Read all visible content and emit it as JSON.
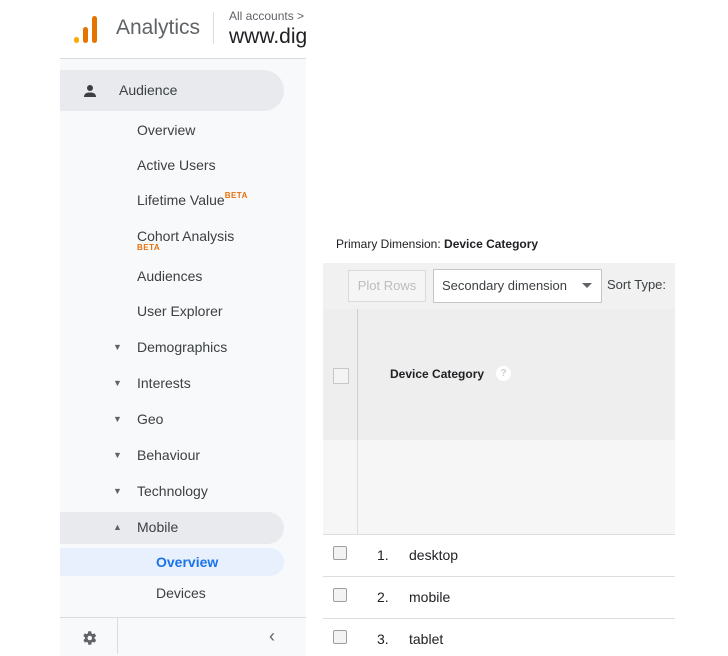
{
  "header": {
    "app_title": "Analytics",
    "all_accounts": "All accounts >",
    "property_name": "www.dig",
    "logo_colors": [
      "#f9ab00",
      "#e37400",
      "#e37400"
    ]
  },
  "sidebar": {
    "section": {
      "label": "Audience",
      "icon": "person-icon"
    },
    "items": [
      {
        "label": "Overview"
      },
      {
        "label": "Active Users"
      },
      {
        "label": "Lifetime Value",
        "badge": "BETA"
      },
      {
        "label": "Cohort Analysis",
        "badge": "BETA"
      },
      {
        "label": "Audiences"
      },
      {
        "label": "User Explorer"
      }
    ],
    "categories": [
      {
        "label": "Demographics",
        "expanded": false
      },
      {
        "label": "Interests",
        "expanded": false
      },
      {
        "label": "Geo",
        "expanded": false
      },
      {
        "label": "Behaviour",
        "expanded": false
      },
      {
        "label": "Technology",
        "expanded": false
      },
      {
        "label": "Mobile",
        "expanded": true
      }
    ],
    "mobile_items": [
      {
        "label": "Overview",
        "active": true
      },
      {
        "label": "Devices"
      }
    ],
    "bottom": {
      "settings_icon": "gear-icon",
      "collapse_icon": "chevron-left-icon"
    },
    "accent_color": "#1a73e8",
    "beta_color": "#e8710a"
  },
  "report": {
    "primary_dimension_label": "Primary Dimension:",
    "primary_dimension_value": "Device Category",
    "toolbar": {
      "plot_rows": "Plot Rows",
      "secondary_dimension": "Secondary dimension",
      "sort_type": "Sort Type:"
    },
    "table": {
      "column_header": "Device Category",
      "help_icon_text": "?",
      "rows": [
        {
          "num": "1.",
          "name": "desktop"
        },
        {
          "num": "2.",
          "name": "mobile"
        },
        {
          "num": "3.",
          "name": "tablet"
        }
      ]
    }
  }
}
